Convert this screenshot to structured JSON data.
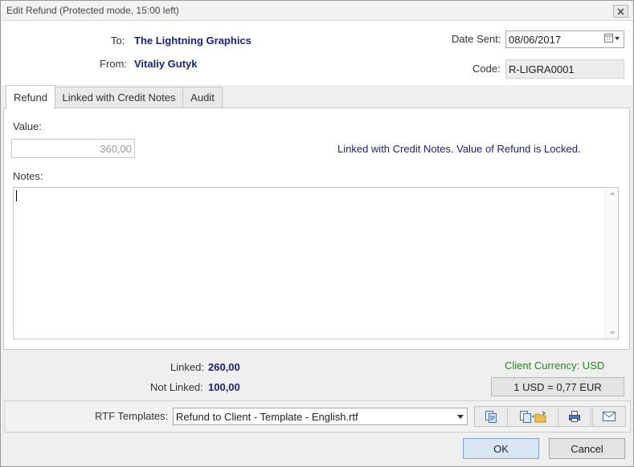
{
  "window": {
    "title": "Edit Refund (Protected mode, 15:00 left)"
  },
  "header": {
    "to_label": "To:",
    "to_value": "The Lightning Graphics",
    "from_label": "From:",
    "from_value": "Vitaliy Gutyk",
    "date_sent_label": "Date Sent:",
    "date_sent_value": "08/06/2017",
    "code_label": "Code:",
    "code_value": "R-LIGRA0001"
  },
  "tabs": [
    {
      "label": "Refund",
      "active": true
    },
    {
      "label": "Linked with Credit Notes",
      "active": false
    },
    {
      "label": "Audit",
      "active": false
    }
  ],
  "refund_tab": {
    "value_label": "Value:",
    "value": "360,00",
    "locked_message": "Linked with Credit Notes. Value of Refund is Locked.",
    "notes_label": "Notes:",
    "notes_value": ""
  },
  "totals": {
    "linked_label": "Linked:",
    "linked_value": "260,00",
    "not_linked_label": "Not Linked:",
    "not_linked_value": "100,00",
    "client_currency": "Client Currency: USD",
    "exchange_rate": "1 USD = 0,77 EUR"
  },
  "templates": {
    "label": "RTF Templates:",
    "selected": "Refund to Client - Template - English.rtf",
    "buttons": [
      "copy-document-icon",
      "open-folder-icon",
      "printer-icon",
      "envelope-icon"
    ]
  },
  "footer": {
    "ok_label": "OK",
    "cancel_label": "Cancel"
  },
  "colors": {
    "accent": "#1a237e",
    "currency_green": "#1e8a1e"
  }
}
